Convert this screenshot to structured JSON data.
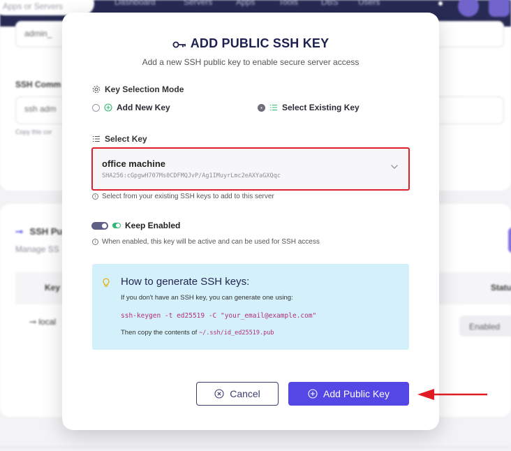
{
  "background": {
    "search_placeholder": "Apps or Servers",
    "nav": [
      "Dashboard",
      "Servers",
      "Apps",
      "Tools",
      "DBS",
      "Users"
    ],
    "username_value": "admin_",
    "ssh_command_label": "SSH Comm",
    "ssh_command_value": "ssh adm",
    "ssh_command_help": "Copy this cor",
    "ssh_section_title": "SSH Pu",
    "ssh_section_desc": "Manage SS",
    "table_key_header": "Key",
    "table_status_header": "Statu",
    "row_key": "local",
    "row_status": "Enabled"
  },
  "modal": {
    "title": "ADD PUBLIC SSH KEY",
    "subtitle": "Add a new SSH public key to enable secure server access",
    "mode_label": "Key Selection Mode",
    "option_new": "Add New Key",
    "option_existing": "Select Existing Key",
    "selected_option": "Select Existing Key",
    "select_label": "Select Key",
    "selected_key_name": "office machine",
    "selected_key_fingerprint": "SHA256:cGpgwH707Ms0CDFMQJvP/Ag1IMuyrLmc2eAXYaGXQqc",
    "select_hint": "Select from your existing SSH keys to add to this server",
    "keep_enabled_label": "Keep Enabled",
    "keep_enabled_value": true,
    "keep_enabled_hint": "When enabled, this key will be active and can be used for SSH access",
    "how_to": {
      "title": "How to generate SSH keys:",
      "intro": "If you don't have an SSH key, you can generate one using:",
      "command": "ssh-keygen -t ed25519 -C \"your_email@example.com\"",
      "then_text": "Then copy the contents of",
      "path": "~/.ssh/id_ed25519.pub"
    },
    "cancel_label": "Cancel",
    "submit_label": "Add Public Key"
  },
  "colors": {
    "accent": "#5447e6",
    "highlight_border": "#e0202b",
    "info_panel_bg": "#d4f0fb",
    "code_color": "#b12d7a",
    "arrow": "#e01b24"
  },
  "icons": [
    "key-icon",
    "gear-icon",
    "plus-circle-icon",
    "list-icon",
    "chevron-down-icon",
    "info-icon",
    "bulb-icon",
    "x-circle-icon",
    "arrow-left-icon"
  ]
}
